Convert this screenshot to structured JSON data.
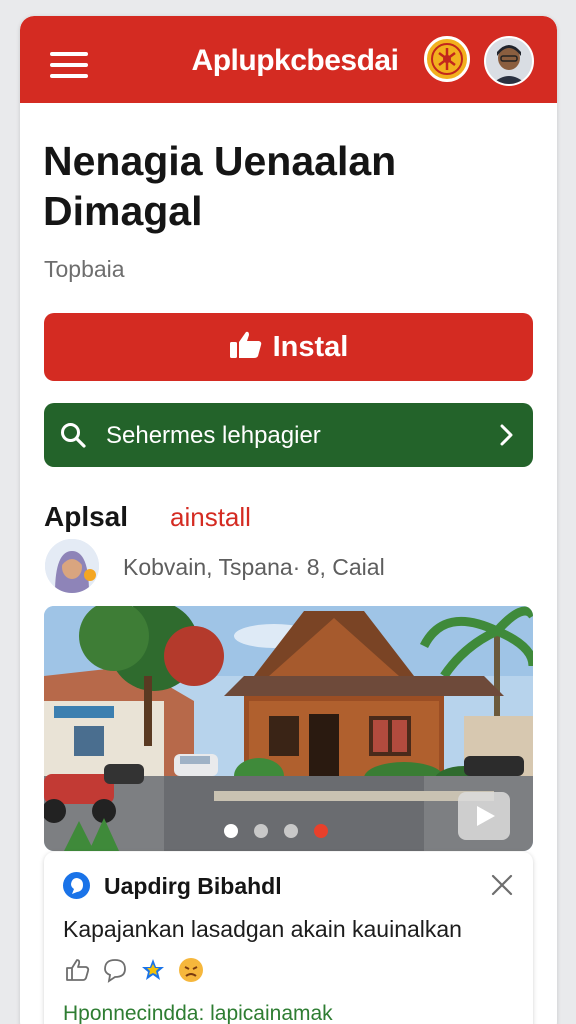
{
  "header": {
    "title": "Aplupkcbesdai",
    "menu_icon": "hamburger-menu-icon",
    "logo_icon": "emblem-logo",
    "profile_icon": "user-avatar"
  },
  "main": {
    "headline": "Nenagia Uenaalan Dimagal",
    "subtitle": "Topbaia",
    "install_button": {
      "label": "Instal",
      "icon": "thumbs-up-icon"
    },
    "search_button": {
      "label": "Sehermes lehpagier",
      "icon": "search-icon",
      "trailing_icon": "chevron-right-icon"
    }
  },
  "section": {
    "title": "Aplsal",
    "link": "ainstall",
    "author_meta": "Kobvain, Tspana· 8, Caial"
  },
  "carousel": {
    "slide_count": 4,
    "active_index": 3,
    "play_icon": "play-icon"
  },
  "notification": {
    "title": "Uapdirg Bibahdl",
    "body": "Kapajankan lasadgan akain kauinalkan",
    "footer": "Hponnecindda: lapicainamak",
    "close_icon": "close-icon",
    "reactions": [
      "thumbs-up-icon",
      "comment-icon",
      "star-icon",
      "angry-face-icon"
    ]
  },
  "colors": {
    "primary_red": "#d42b22",
    "green": "#23632a",
    "background": "#e9eaec",
    "accent_blue": "#1a73e8"
  }
}
